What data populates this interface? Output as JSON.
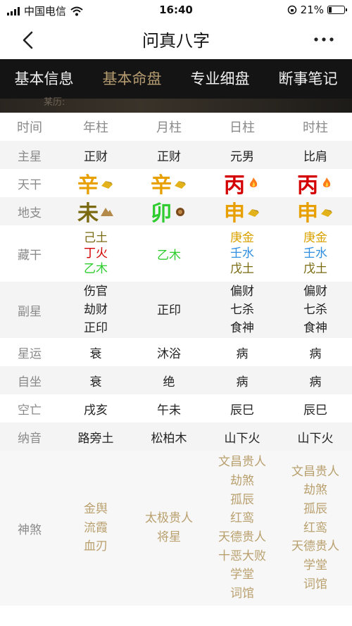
{
  "status": {
    "carrier": "中国电信",
    "time": "16:40",
    "battery": "21%",
    "battery_level": 0.21
  },
  "nav": {
    "title": "问真八字"
  },
  "tabs": [
    {
      "label": "基本信息"
    },
    {
      "label": "基本命盘"
    },
    {
      "label": "专业细盘"
    },
    {
      "label": "断事笔记"
    }
  ],
  "banner": {
    "partial_text": "某历:"
  },
  "table": {
    "header": [
      "时间",
      "年柱",
      "月柱",
      "日柱",
      "时柱"
    ],
    "zhuxing": {
      "label": "主星",
      "values": [
        "正财",
        "正财",
        "元男",
        "比肩"
      ]
    },
    "tiangan": {
      "label": "天干",
      "values": [
        "辛",
        "辛",
        "丙",
        "丙"
      ]
    },
    "dizhi": {
      "label": "地支",
      "values": [
        "未",
        "卯",
        "申",
        "申"
      ]
    },
    "canggan": {
      "label": "藏干",
      "values": [
        [
          "己土",
          "丁火",
          "乙木"
        ],
        [
          "乙木"
        ],
        [
          "庚金",
          "壬水",
          "戊土"
        ],
        [
          "庚金",
          "壬水",
          "戊土"
        ]
      ]
    },
    "fuxing": {
      "label": "副星",
      "values": [
        [
          "伤官",
          "劫财",
          "正印"
        ],
        [
          "正印"
        ],
        [
          "偏财",
          "七杀",
          "食神"
        ],
        [
          "偏财",
          "七杀",
          "食神"
        ]
      ]
    },
    "xingyun": {
      "label": "星运",
      "values": [
        "衰",
        "沐浴",
        "病",
        "病"
      ]
    },
    "zizuo": {
      "label": "自坐",
      "values": [
        "衰",
        "绝",
        "病",
        "病"
      ]
    },
    "kongwang": {
      "label": "空亡",
      "values": [
        "戌亥",
        "午未",
        "辰巳",
        "辰巳"
      ]
    },
    "nayin": {
      "label": "纳音",
      "values": [
        "路旁土",
        "松柏木",
        "山下火",
        "山下火"
      ]
    },
    "shensha": {
      "label": "神煞",
      "values": [
        [
          "金舆",
          "流霞",
          "血刃"
        ],
        [
          "太极贵人",
          "将星"
        ],
        [
          "文昌贵人",
          "劫煞",
          "孤辰",
          "红鸾",
          "天德贵人",
          "十恶大败",
          "学堂",
          "词馆"
        ],
        [
          "文昌贵人",
          "劫煞",
          "孤辰",
          "红鸾",
          "天德贵人",
          "学堂",
          "词馆"
        ]
      ]
    }
  },
  "colors": {
    "tab_active": "#b59b70",
    "metal": "#d9a200",
    "earth": "#7a6a12",
    "fire": "#d40000",
    "wood": "#2ecc2e",
    "water": "#2f8fe0",
    "shensha": "#b9a06e"
  }
}
